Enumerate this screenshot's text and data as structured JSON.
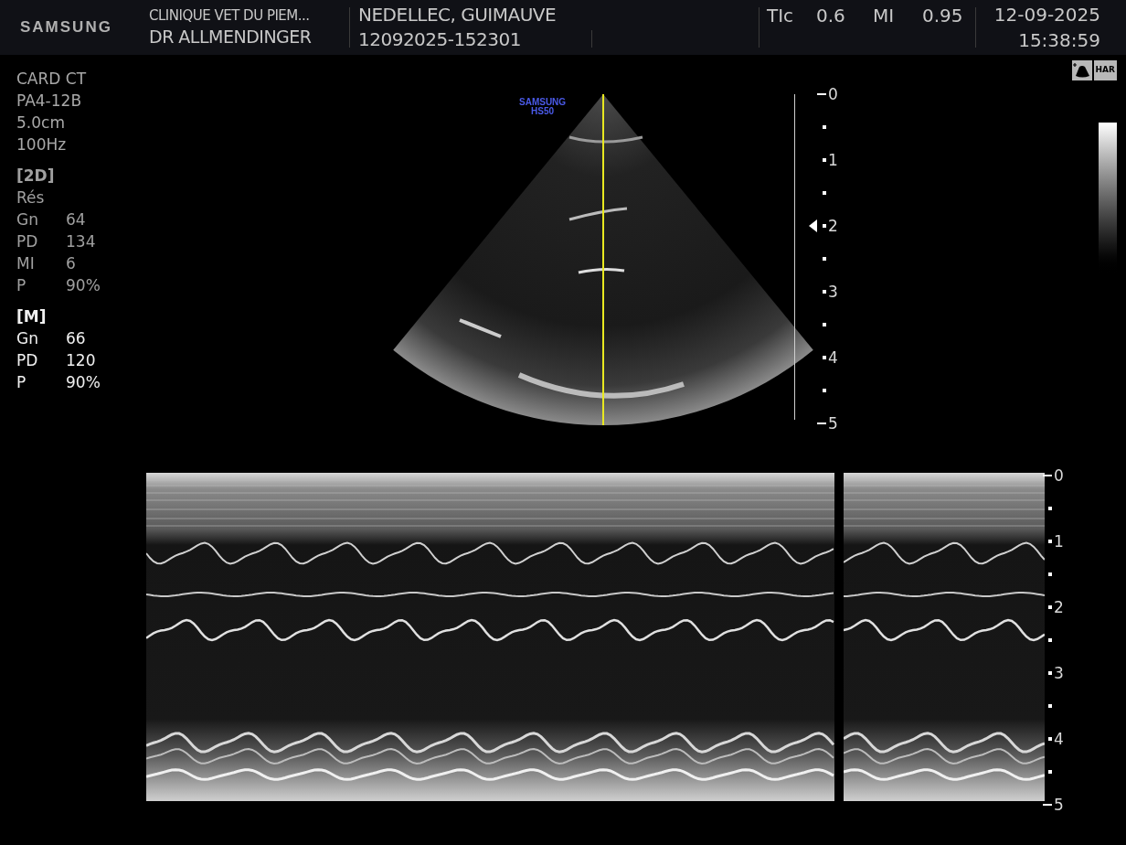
{
  "header": {
    "logo": "SAMSUNG",
    "institution": "CLINIQUE VET DU PIEM...",
    "operator": "DR ALLMENDINGER",
    "patient_name": "NEDELLEC, GUIMAUVE",
    "patient_id": "12092025-152301",
    "indices": [
      {
        "label": "TIc",
        "value": "0.6"
      },
      {
        "label": "MI",
        "value": "0.95"
      }
    ],
    "date": "12-09-2025",
    "time": "15:38:59"
  },
  "mode_badge": "HAR",
  "probe_info": [
    "CARD CT",
    "PA4-12B",
    "5.0cm",
    "100Hz"
  ],
  "groups": [
    {
      "title": "[2D]",
      "selected": false,
      "rows": [
        {
          "label": "Rés"
        },
        {
          "label": "Gn",
          "value": "64"
        },
        {
          "label": "PD",
          "value": "134"
        },
        {
          "label": "MI",
          "value": "6"
        },
        {
          "label": "P",
          "value": "90%"
        }
      ]
    },
    {
      "title": "[M]",
      "selected": true,
      "rows": [
        {
          "label": "Gn",
          "value": "66"
        },
        {
          "label": "PD",
          "value": "120"
        },
        {
          "label": "P",
          "value": "90%"
        }
      ]
    }
  ],
  "image_logo": [
    "SAMSUNG",
    "HS50"
  ],
  "depth_scale_2d": [
    {
      "label": "0",
      "focus": false
    },
    {
      "label": "1",
      "focus": false
    },
    {
      "label": "2",
      "focus": true
    },
    {
      "label": "3",
      "focus": false
    },
    {
      "label": "4",
      "focus": false
    },
    {
      "label": "5",
      "focus": false
    }
  ],
  "depth_scale_mmode": {
    "labels": [
      "0",
      "1",
      "2",
      "3",
      "4",
      "5"
    ]
  }
}
